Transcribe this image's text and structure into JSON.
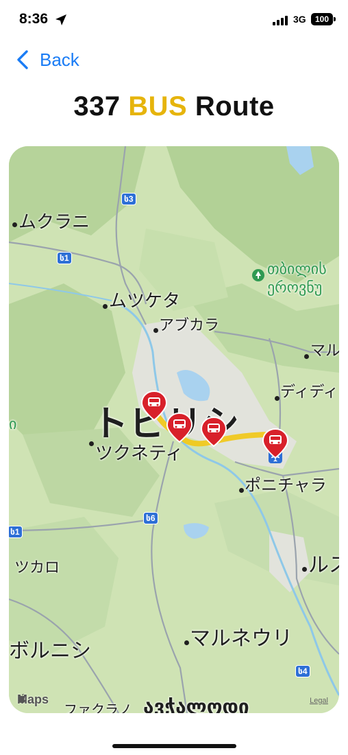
{
  "status_bar": {
    "time": "8:36",
    "network": "3G",
    "battery": "100"
  },
  "nav": {
    "back_label": "Back"
  },
  "title": {
    "number": "337",
    "bus": "BUS",
    "route": "Route"
  },
  "colors": {
    "accent": "#1a7cf5",
    "bus_yellow": "#e6b40c",
    "pin_red": "#d8202a",
    "route_yellow": "#f2c614"
  },
  "map": {
    "labels": {
      "mukrani": "ムクラニ",
      "mtskheta": "ムツケタ",
      "avchala": "アブカラ",
      "tbilisi": "トビリシ",
      "tskneti": "ツクネティ",
      "didi": "ディディ",
      "maru": "マル",
      "ponichala": "ポニチャラ",
      "tskaro": "ツカロ",
      "marneuli": "マルネウリ",
      "bolnisi": "ボルニシ",
      "rusa": "ルス",
      "fakrano": "ファクラノ",
      "georgian_a": "თბილის",
      "georgian_b": "ეროვნუ",
      "georgian_c": "ავჭალოდი",
      "left_green": "ი"
    },
    "shields": {
      "s3": "ს3",
      "s1a": "ს1",
      "s1b": "ს1",
      "s6": "ს6",
      "s4": "ს4"
    },
    "attribution": "Maps",
    "legal": "Legal"
  }
}
